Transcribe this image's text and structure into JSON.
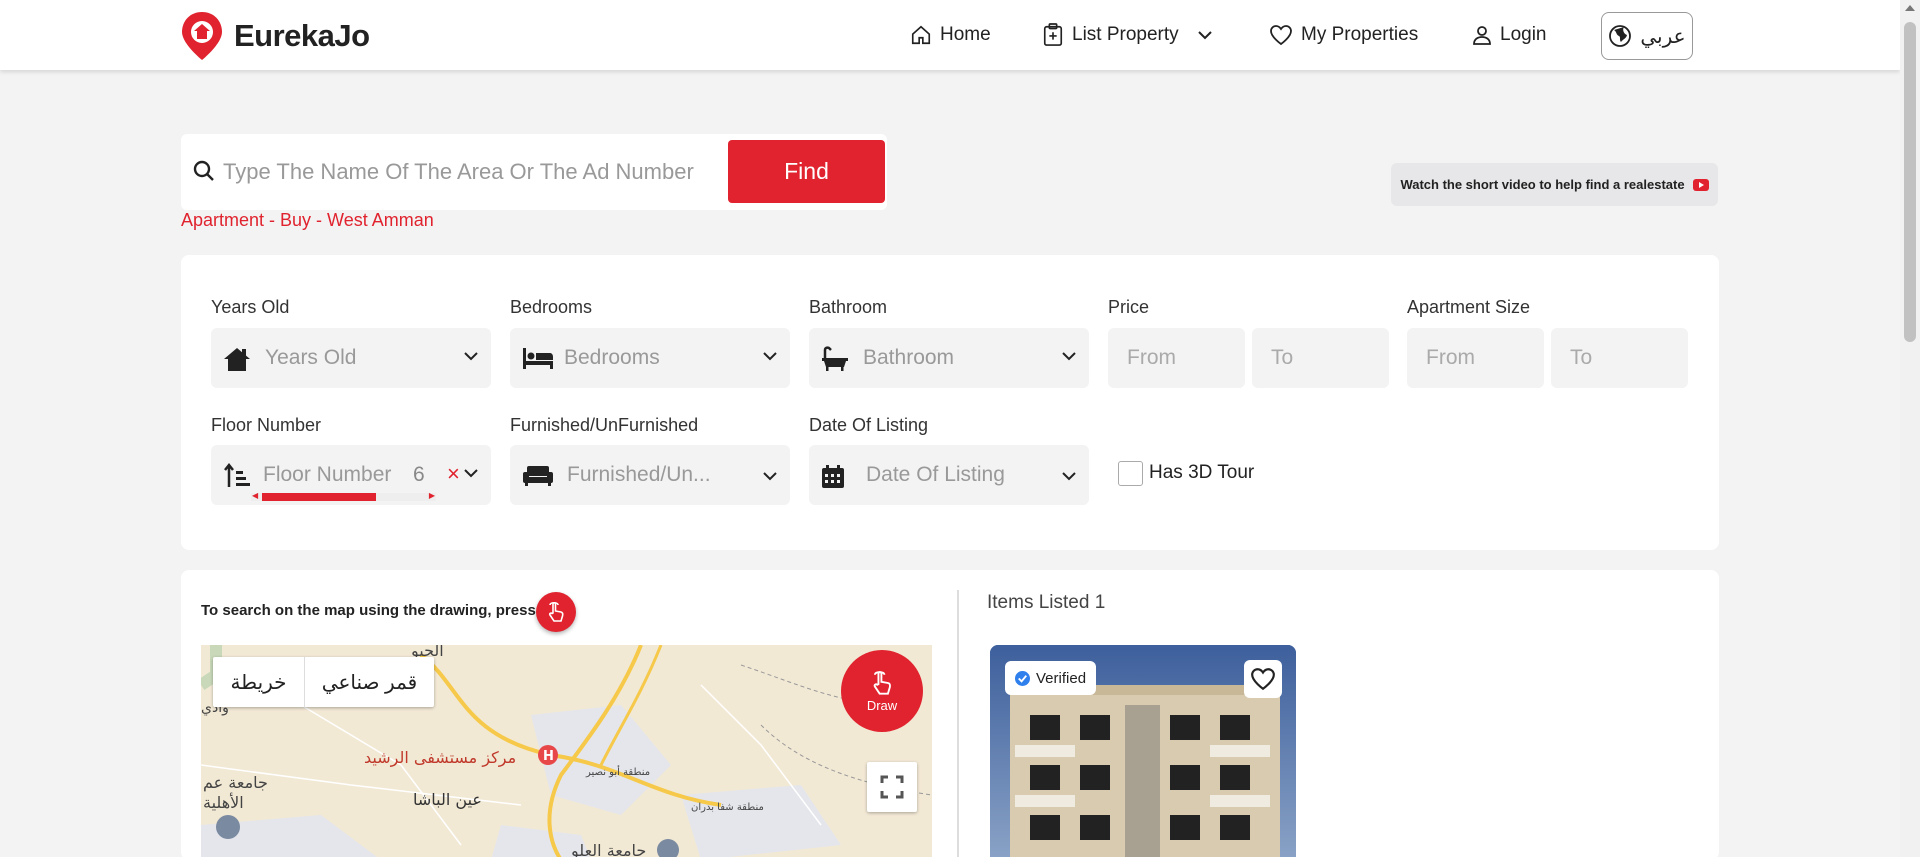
{
  "header": {
    "brand": "EurekaJo",
    "nav": {
      "home": "Home",
      "list_property": "List Property",
      "my_properties": "My Properties",
      "login": "Login",
      "language": "عربي"
    }
  },
  "search": {
    "placeholder": "Type The Name Of The Area Or The Ad Number",
    "value": "",
    "find_label": "Find",
    "breadcrumb": "Apartment - Buy - West Amman",
    "video_hint": "Watch the short video to help find a realestate"
  },
  "filters": {
    "years_old": {
      "label": "Years Old",
      "placeholder": "Years Old"
    },
    "bedrooms": {
      "label": "Bedrooms",
      "placeholder": "Bedrooms"
    },
    "bathroom": {
      "label": "Bathroom",
      "placeholder": "Bathroom"
    },
    "price": {
      "label": "Price",
      "from": "From",
      "to": "To"
    },
    "apartment_size": {
      "label": "Apartment Size",
      "from": "From",
      "to": "To"
    },
    "floor_number": {
      "label": "Floor Number",
      "placeholder": "Floor Number",
      "value": "6",
      "scroll_fill": 0.7
    },
    "furnished": {
      "label": "Furnished/UnFurnished",
      "placeholder": "Furnished/Un..."
    },
    "date_of_listing": {
      "label": "Date Of Listing",
      "placeholder": "Date Of Listing"
    },
    "has_3d_tour": {
      "label": "Has 3D Tour",
      "checked": false
    }
  },
  "map": {
    "draw_hint": "To search on the map using the drawing, press",
    "toggle_map": "خريطة",
    "toggle_satellite": "قمر صناعي",
    "draw_label": "Draw",
    "labels": [
      "مركز مستشفى الرشيد",
      "عين الباشا",
      "جامعة عم",
      "الأهلية",
      "وادي",
      "منطقة أبو نصير",
      "منطقة شفا بدران",
      "الجبو",
      "جامعة العلو"
    ]
  },
  "results": {
    "items_listed": "Items Listed 1",
    "card": {
      "badge": "Verified"
    }
  },
  "colors": {
    "accent": "#e0232e",
    "background": "#f3f3f3"
  }
}
